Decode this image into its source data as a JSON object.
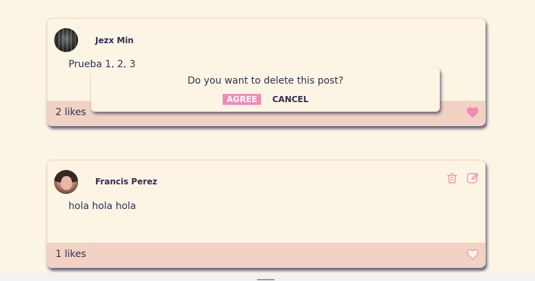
{
  "posts": [
    {
      "author": "Jezx Min",
      "text": "Prueba 1, 2, 3",
      "likes": "2 likes",
      "liked": true,
      "avatar_icon": "user-avatar-photo"
    },
    {
      "author": "Francis Perez",
      "text": "hola hola hola",
      "likes": "1 likes",
      "liked": false,
      "avatar_icon": "user-avatar-photo",
      "actions": {
        "delete_icon": "trash-icon",
        "edit_icon": "edit-icon"
      }
    }
  ],
  "dialog": {
    "question": "Do you want to delete this post?",
    "agree_label": "AGREE",
    "cancel_label": "CANCEL"
  },
  "colors": {
    "background": "#fdf5e4",
    "footer": "#f1d2c3",
    "accent": "#f28ab2",
    "text": "#2f2d55"
  }
}
